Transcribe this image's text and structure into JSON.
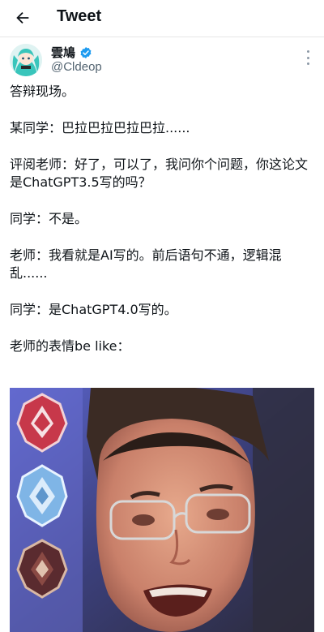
{
  "header": {
    "back_icon": "arrow-left-icon",
    "title": "Tweet"
  },
  "author": {
    "display_name": "雲鳩",
    "handle": "@Cldeop",
    "verified_icon": "verified-badge-icon",
    "verified_color": "#1d9bf0",
    "more_icon": "more-vertical-icon"
  },
  "tweet": {
    "lines": [
      "答辩现场。",
      "某同学：巴拉巴拉巴拉巴拉......",
      "评阅老师：好了，可以了，我问你个问题，你这论文是ChatGPT3.5写的吗？",
      "同学：不是。",
      "老师：我看就是AI写的。前后语句不通，逻辑混乱......",
      "同学：是ChatGPT4.0写的。",
      "老师的表情be like："
    ]
  },
  "media": {
    "icons": [
      "red-rank-badge-icon",
      "blue-rank-badge-icon",
      "dark-rank-badge-icon"
    ]
  },
  "colors": {
    "text": "#0f1419",
    "secondary": "#536471",
    "media_bg": "#3a3a52"
  }
}
